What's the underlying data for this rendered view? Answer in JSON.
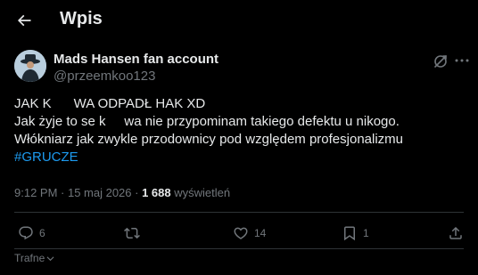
{
  "header": {
    "title": "Wpis"
  },
  "author": {
    "display_name": "Mads Hansen fan account",
    "handle": "@przeemkoo123"
  },
  "tweet": {
    "lines": [
      "JAK K      WA ODPADŁ HAK XD",
      "Jak żyje to se k     wa nie przypominam takiego defektu u nikogo.",
      "Włókniarz jak zwykle przodownicy pod względem profesjonalizmu"
    ],
    "hashtag": "#GRUCZE"
  },
  "meta": {
    "timestamp": "9:12 PM · 15 maj 2026 · ",
    "views": "1 688",
    "views_label": " wyświetleń"
  },
  "actions": {
    "replies": "6",
    "reposts": "",
    "likes": "14",
    "bookmarks": "1"
  },
  "sort": {
    "label": "Trafne"
  },
  "colors": {
    "background": "#000000",
    "text": "#e7e9ea",
    "muted": "#71767b",
    "accent": "#1d9bf0",
    "border": "#2f3336"
  },
  "icons": {
    "back": "arrow-left-icon",
    "grok": "grok-icon",
    "more": "more-dots-icon",
    "reply": "reply-bubble-icon",
    "repost": "repost-icon",
    "like": "heart-icon",
    "bookmark": "bookmark-icon",
    "share": "share-icon",
    "sort": "chevron-down-icon"
  }
}
